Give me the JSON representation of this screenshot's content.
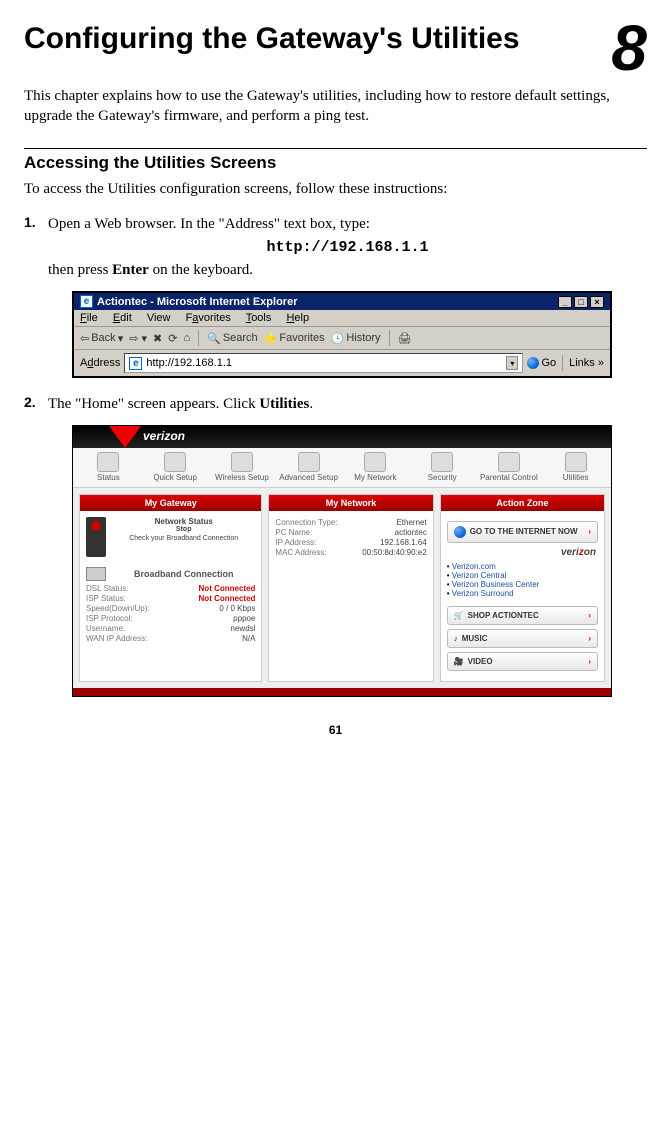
{
  "chapter": {
    "title": "Configuring the Gateway's Utilities",
    "number": "8"
  },
  "intro": "This chapter explains how to use the Gateway's utilities, including how to restore default settings, upgrade the Gateway's firmware, and perform a ping test.",
  "section": {
    "heading": "Accessing the Utilities Screens",
    "lead": "To access the Utilities configuration screens, follow these instructions:"
  },
  "steps": {
    "s1": {
      "num": "1.",
      "text_a": "Open a Web browser. In the \"Address\" text box, type:",
      "url": "http://192.168.1.1",
      "text_b_pre": "then press ",
      "text_b_bold": "Enter",
      "text_b_post": " on the keyboard."
    },
    "s2": {
      "num": "2.",
      "text_pre": "The \"Home\" screen appears. Click ",
      "text_bold": "Utilities",
      "text_post": "."
    }
  },
  "ie": {
    "title": "Actiontec - Microsoft Internet Explorer",
    "menu": {
      "file": "File",
      "edit": "Edit",
      "view": "View",
      "fav": "Favorites",
      "tools": "Tools",
      "help": "Help"
    },
    "toolbar": {
      "back": "Back",
      "search": "Search",
      "favorites": "Favorites",
      "history": "History"
    },
    "address_label": "Address",
    "address_value": "http://192.168.1.1",
    "go": "Go",
    "links": "Links"
  },
  "gw": {
    "brand": "verizon",
    "tabs": {
      "t0": "Status",
      "t1": "Quick Setup",
      "t2": "Wireless Setup",
      "t3": "Advanced Setup",
      "t4": "My Network",
      "t5": "Security",
      "t6": "Parental Control",
      "t7": "Utilities"
    },
    "col1": {
      "hdr": "My Gateway",
      "ns_title": "Network Status",
      "ns_sub": "Stop",
      "ns_check": "Check your Broadband Connection",
      "bb_title": "Broadband Connection",
      "rows": {
        "r0k": "DSL Status:",
        "r0v": "Not Connected",
        "r1k": "ISP Status:",
        "r1v": "Not Connected",
        "r2k": "Speed(Down/Up):",
        "r2v": "0 / 0 Kbps",
        "r3k": "ISP Protocol:",
        "r3v": "pppoe",
        "r4k": "Username:",
        "r4v": "newdsl",
        "r5k": "WAN IP Address:",
        "r5v": "N/A"
      }
    },
    "col2": {
      "hdr": "My Network",
      "rows": {
        "r0k": "Connection Type:",
        "r0v": "Ethernet",
        "r1k": "PC Name:",
        "r1v": "actiontec",
        "r2k": "IP Address:",
        "r2v": "192.168.1.64",
        "r3k": "MAC Address:",
        "r3v": "00:50:8d:40:90:e2"
      }
    },
    "col3": {
      "hdr": "Action Zone",
      "go_internet": "GO TO THE INTERNET NOW",
      "links": {
        "l0": "Verizon.com",
        "l1": "Verizon Central",
        "l2": "Verizon Business Center",
        "l3": "Verizon Surround"
      },
      "b_shop": "SHOP ACTIONTEC",
      "b_music": "MUSIC",
      "b_video": "VIDEO"
    }
  },
  "page_number": "61"
}
